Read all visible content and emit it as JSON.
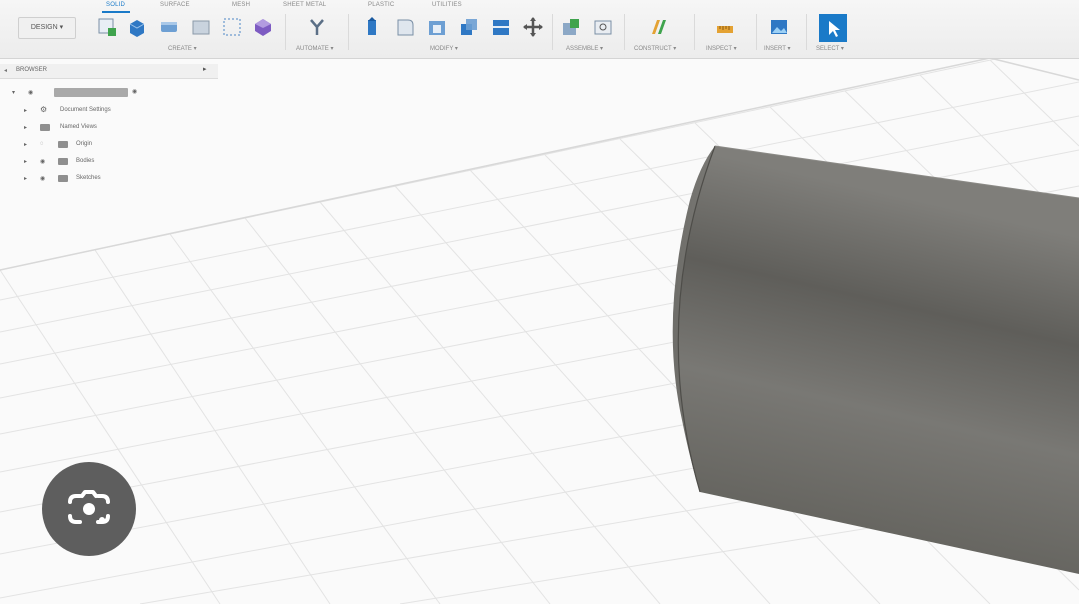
{
  "colors": {
    "accent": "#1a7ac8",
    "cylinder": "#6b6a66",
    "grid": "#dcdcdc",
    "overlay_button": "#5e5e5e"
  },
  "toolbar": {
    "workspace": "DESIGN",
    "tabs": [
      "SOLID",
      "SURFACE",
      "MESH",
      "SHEET METAL",
      "PLASTIC",
      "UTILITIES"
    ],
    "active_tab": "SOLID",
    "groups": [
      "CREATE",
      "AUTOMATE",
      "MODIFY",
      "ASSEMBLE",
      "CONSTRUCT",
      "INSPECT",
      "INSERT",
      "SELECT"
    ]
  },
  "browser": {
    "title": "BROWSER",
    "items": [
      {
        "label": "Document Settings",
        "icon": "gear-icon"
      },
      {
        "label": "Named Views",
        "icon": "folder-icon"
      },
      {
        "label": "Origin",
        "icon": "folder-icon"
      },
      {
        "label": "Bodies",
        "icon": "folder-icon"
      },
      {
        "label": "Sketches",
        "icon": "folder-icon"
      }
    ]
  },
  "overlay": {
    "icon": "lens-camera-icon"
  }
}
